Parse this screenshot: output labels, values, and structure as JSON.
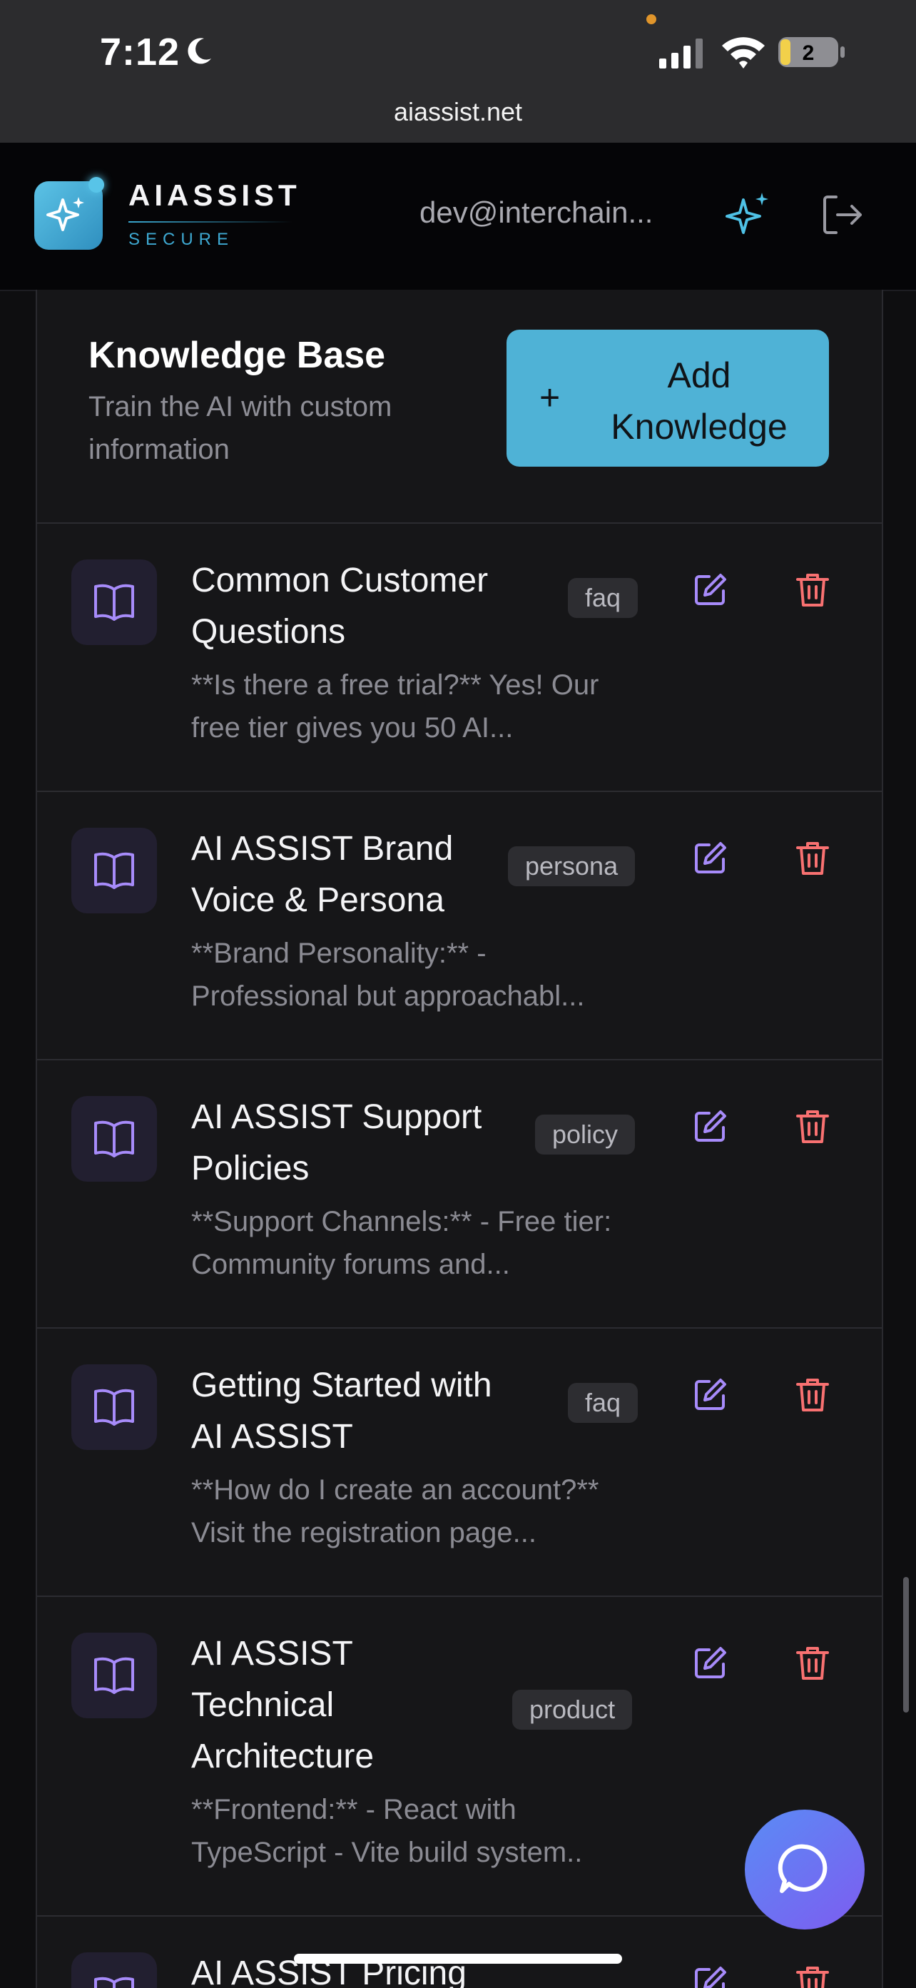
{
  "status_bar": {
    "time": "7:12",
    "battery_level": "2",
    "url": "aiassist.net"
  },
  "header": {
    "brand": "AIASSIST",
    "brand_sub": "SECURE",
    "user_email": "dev@interchain...",
    "accent_color": "#4fb2d6"
  },
  "knowledge_base": {
    "title": "Knowledge Base",
    "subtitle": "Train the AI with custom information",
    "add_button_icon": "+",
    "add_button_label": "Add Knowledge"
  },
  "items": [
    {
      "title": "Common Customer Questions",
      "tag": "faq",
      "description": "**Is there a free trial?** Yes! Our free tier gives you 50 AI...",
      "icon": "book-icon"
    },
    {
      "title": "AI ASSIST Brand Voice & Persona",
      "tag": "persona",
      "description": "**Brand Personality:** - Professional but approachabl...",
      "icon": "book-icon"
    },
    {
      "title": "AI ASSIST Support Policies",
      "tag": "policy",
      "description": "**Support Channels:** - Free tier: Community forums and...",
      "icon": "book-icon"
    },
    {
      "title": "Getting Started with AI ASSIST",
      "tag": "faq",
      "description": "**How do I create an account?** Visit the registration page...",
      "icon": "book-icon"
    },
    {
      "title": "AI ASSIST Technical Architecture",
      "tag": "product",
      "description": "**Frontend:** - React with TypeScript - Vite build system..",
      "icon": "book-icon"
    },
    {
      "title": "AI ASSIST Pricing",
      "tag": "",
      "description": "",
      "icon": "book-icon"
    }
  ],
  "colors": {
    "edit": "#a78bfa",
    "delete": "#f87171",
    "card_bg": "#161618",
    "icon_tile": "#221f30"
  }
}
